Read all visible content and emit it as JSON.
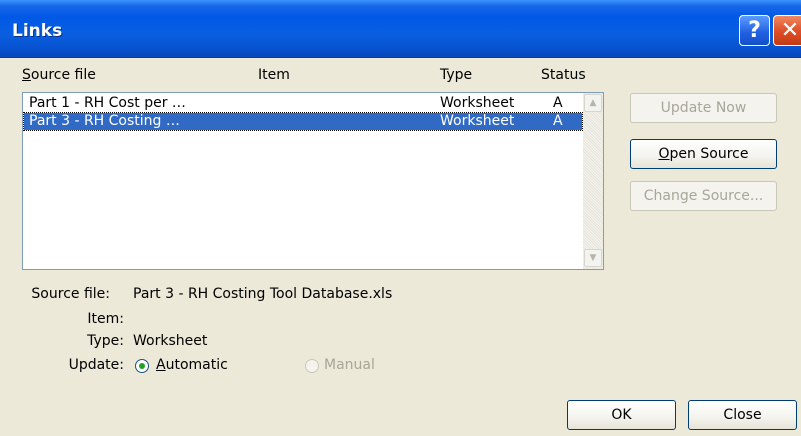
{
  "window": {
    "title": "Links",
    "help_glyph": "?",
    "close_glyph": "✕"
  },
  "list": {
    "headers": {
      "source_file": "Source file",
      "item": "Item",
      "type": "Type",
      "status": "Status"
    },
    "rows": [
      {
        "source": "Part 1 - RH Cost per …",
        "item": "",
        "type": "Worksheet",
        "status": "A",
        "selected": false
      },
      {
        "source": "Part 3 - RH Costing …",
        "item": "",
        "type": "Worksheet",
        "status": "A",
        "selected": true
      }
    ],
    "scroll_up_glyph": "▲",
    "scroll_down_glyph": "▼"
  },
  "buttons": {
    "update_now": "Update Now",
    "open_source": "Open Source",
    "change_source": "Change Source...",
    "ok": "OK",
    "close": "Close"
  },
  "details": {
    "source_file_label": "Source file:",
    "source_file_value": "Part 3 - RH Costing Tool Database.xls",
    "item_label": "Item:",
    "item_value": "",
    "type_label": "Type:",
    "type_value": "Worksheet",
    "update_label": "Update:",
    "automatic_label": "Automatic",
    "manual_label": "Manual",
    "update_selected": "Automatic"
  },
  "colors": {
    "titlebar": "#0058E6",
    "selection": "#316AC5",
    "dialog_bg": "#ECE9D8"
  }
}
